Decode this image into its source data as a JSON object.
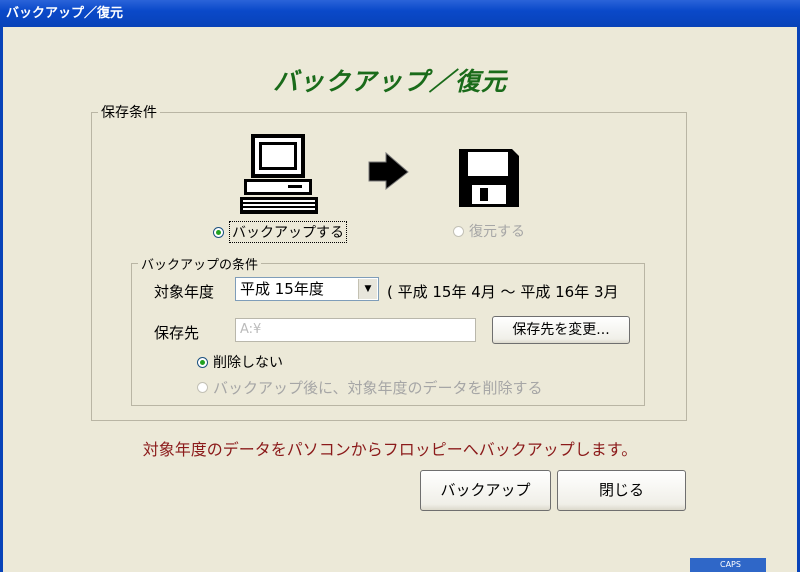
{
  "window": {
    "title": "バックアップ／復元"
  },
  "heading": "バックアップ／復元",
  "save_conditions": {
    "legend": "保存条件",
    "backup_radio": "バックアップする",
    "restore_radio": "復元する"
  },
  "backup_conditions": {
    "legend": "バックアップの条件",
    "year_label": "対象年度",
    "year_value": "平成 15年度",
    "year_range": "( 平成 15年 4月 ～ 平成 16年 3月",
    "dest_label": "保存先",
    "dest_value": "A:¥",
    "change_dest_button": "保存先を変更...",
    "no_delete_radio": "削除しない",
    "delete_radio": "バックアップ後に、対象年度のデータを削除する"
  },
  "message": "対象年度のデータをパソコンからフロッピーへバックアップします。",
  "buttons": {
    "backup": "バックアップ",
    "close": "閉じる"
  },
  "taskbar": {
    "caps": "CAPS"
  },
  "colors": {
    "heading": "#1a6b1a",
    "message": "#8b1a1a",
    "titlebar": "#0a49c9"
  }
}
